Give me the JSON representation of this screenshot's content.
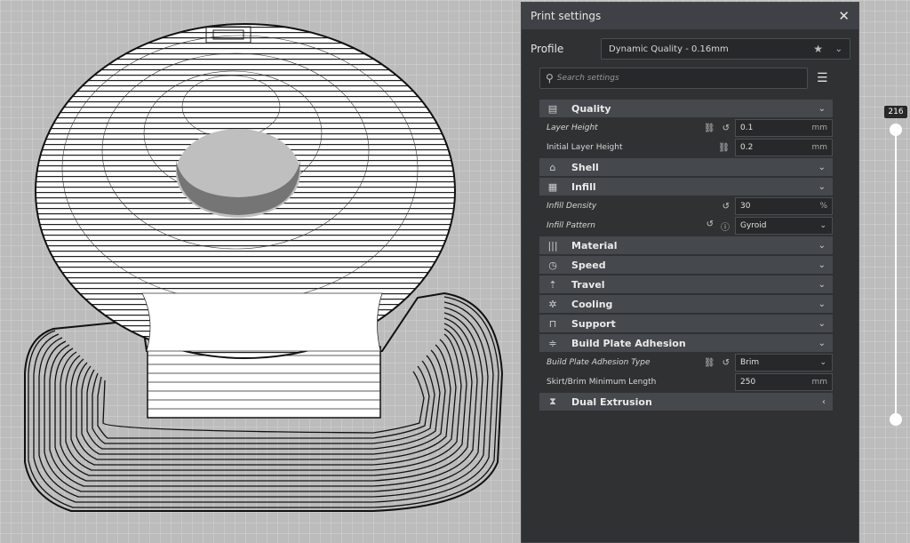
{
  "panel": {
    "title": "Print settings",
    "close_icon": "close-icon"
  },
  "profile": {
    "label": "Profile",
    "value": "Dynamic Quality - 0.16mm"
  },
  "search": {
    "placeholder": "Search settings"
  },
  "categories": {
    "quality": "Quality",
    "shell": "Shell",
    "infill": "Infill",
    "material": "Material",
    "speed": "Speed",
    "travel": "Travel",
    "cooling": "Cooling",
    "support": "Support",
    "adhesion": "Build Plate Adhesion",
    "dual": "Dual Extrusion"
  },
  "settings": {
    "layer_height": {
      "label": "Layer Height",
      "value": "0.1",
      "unit": "mm"
    },
    "initial_layer_height": {
      "label": "Initial Layer Height",
      "value": "0.2",
      "unit": "mm"
    },
    "infill_density": {
      "label": "Infill Density",
      "value": "30",
      "unit": "%"
    },
    "infill_pattern": {
      "label": "Infill Pattern",
      "value": "Gyroid"
    },
    "adhesion_type": {
      "label": "Build Plate Adhesion Type",
      "value": "Brim"
    },
    "skirt_brim_min_length": {
      "label": "Skirt/Brim Minimum Length",
      "value": "250",
      "unit": "mm"
    }
  },
  "layer_slider": {
    "value": "216"
  }
}
